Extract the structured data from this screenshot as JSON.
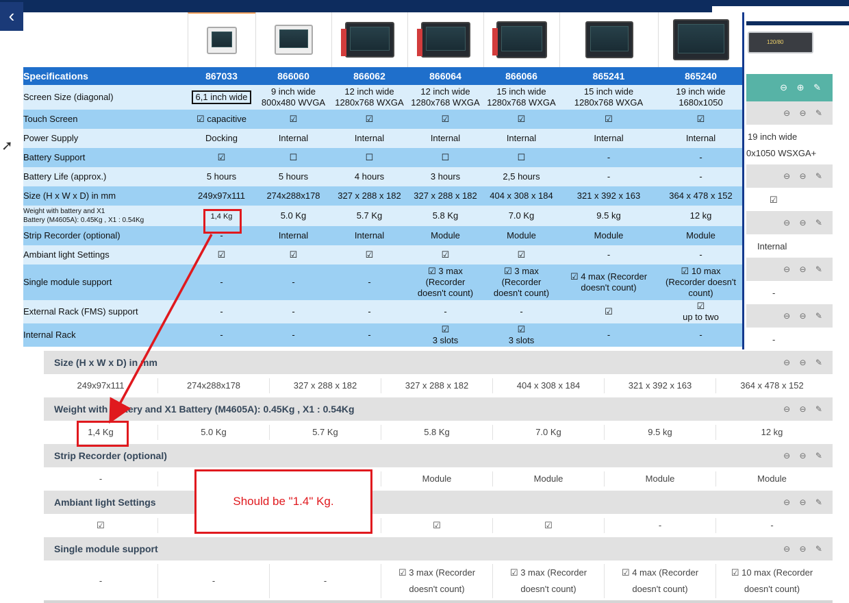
{
  "nav": {
    "back_icon": "‹"
  },
  "right_strip": {
    "monitor_readout": "120/80",
    "text_1": "19 inch wide",
    "text_2": "0x1050 WSXGA+",
    "text_3": "Internal",
    "dash_1": "-",
    "dash_2": "-",
    "icons_teal": "⊖ ⊕ ✎",
    "icons_row": "⊖ ⊖ ✎"
  },
  "overlay": {
    "header": [
      "Specifications",
      "867033",
      "866060",
      "866062",
      "866064",
      "866066",
      "865241",
      "865240"
    ],
    "rows": [
      {
        "label": "Screen Size (diagonal)",
        "cells": [
          "6,1 inch wide",
          "9 inch wide\n800x480 WVGA",
          "12 inch wide\n1280x768 WXGA",
          "12 inch wide\n1280x768 WXGA",
          "15 inch wide\n1280x768 WXGA",
          "15 inch wide\n1280x768 WXGA",
          "19 inch wide\n1680x1050"
        ]
      },
      {
        "label": "Touch Screen",
        "cells": [
          "☑  capacitive",
          "☑",
          "☑",
          "☑",
          "☑",
          "☑",
          "☑"
        ]
      },
      {
        "label": "Power Supply",
        "cells": [
          "Docking",
          "Internal",
          "Internal",
          "Internal",
          "Internal",
          "Internal",
          "Internal"
        ]
      },
      {
        "label": "Battery Support",
        "cells": [
          "☑",
          "☐",
          "☐",
          "☐",
          "☐",
          "-",
          "-"
        ]
      },
      {
        "label": "Battery Life (approx.)",
        "cells": [
          "5 hours",
          "5 hours",
          "4 hours",
          "3 hours",
          "2,5 hours",
          "-",
          "-"
        ]
      },
      {
        "label": "Size (H x W x D) in mm",
        "cells": [
          "249x97x111",
          "274x288x178",
          "327 x 288 x 182",
          "327 x 288 x 182",
          "404 x 308 x 184",
          "321 x 392 x 163",
          "364 x 478 x 152"
        ]
      },
      {
        "label": "Weight with battery and X1\nBattery (M4605A): 0.45Kg , X1 : 0.54Kg",
        "cells": [
          "1,4 Kg",
          "5.0 Kg",
          "5.7 Kg",
          "5.8 Kg",
          "7.0 Kg",
          "9.5 kg",
          "12 kg"
        ]
      },
      {
        "label": "Strip Recorder (optional)",
        "cells": [
          "-",
          "Internal",
          "Internal",
          "Module",
          "Module",
          "Module",
          "Module"
        ]
      },
      {
        "label": "Ambiant light Settings",
        "cells": [
          "☑",
          "☑",
          "☑",
          "☑",
          "☑",
          "-",
          "-"
        ]
      },
      {
        "label": "Single module support",
        "cells": [
          "-",
          "-",
          "-",
          "☑ 3 max\n(Recorder\ndoesn't count)",
          "☑ 3 max\n(Recorder\ndoesn't count)",
          "☑ 4 max (Recorder\ndoesn't count)",
          "☑ 10 max\n(Recorder doesn't\ncount)"
        ]
      },
      {
        "label": "External Rack (FMS) support",
        "cells": [
          "-",
          "-",
          "-",
          "-",
          "-",
          "☑",
          "☑\nup to two"
        ]
      },
      {
        "label": "Internal Rack",
        "cells": [
          "-",
          "-",
          "-",
          "☑\n3 slots",
          "☑\n3 slots",
          "-",
          "-"
        ]
      }
    ]
  },
  "back": {
    "sections": [
      {
        "title": "Size (H x W x D) in mm",
        "cells": [
          "249x97x111",
          "274x288x178",
          "327 x 288 x 182",
          "327 x 288 x 182",
          "404 x 308 x 184",
          "321 x 392 x 163",
          "364 x 478 x 152"
        ]
      },
      {
        "title": "Weight with battery and X1 Battery (M4605A): 0.45Kg , X1 : 0.54Kg",
        "cells": [
          "1,4 Kg",
          "5.0 Kg",
          "5.7 Kg",
          "5.8 Kg",
          "7.0 Kg",
          "9.5 kg",
          "12 kg"
        ]
      },
      {
        "title": "Strip Recorder (optional)",
        "cells": [
          "-",
          "",
          "",
          "Module",
          "Module",
          "Module",
          "Module"
        ]
      },
      {
        "title": "Ambiant light Settings",
        "cells": [
          "☑",
          "",
          "",
          "☑",
          "☑",
          "-",
          "-"
        ]
      },
      {
        "title": "Single module support",
        "cells": [
          "-",
          "-",
          "-",
          "☑ 3 max (Recorder\ndoesn't count)",
          "☑ 3 max (Recorder\ndoesn't count)",
          "☑ 4 max (Recorder\ndoesn't count)",
          "☑ 10 max (Recorder\ndoesn't count)"
        ]
      }
    ],
    "row_icons": "⊖ ⊖ ✎"
  },
  "annotation": {
    "callout": "Should be \"1.4\" Kg.",
    "color": "#e0191e"
  },
  "colors": {
    "header_blue": "#1f6fcb",
    "row_light": "#dbeefb",
    "row_dark": "#9cd0f3",
    "navy": "#0d2c5e",
    "teal": "#57b3a6"
  }
}
